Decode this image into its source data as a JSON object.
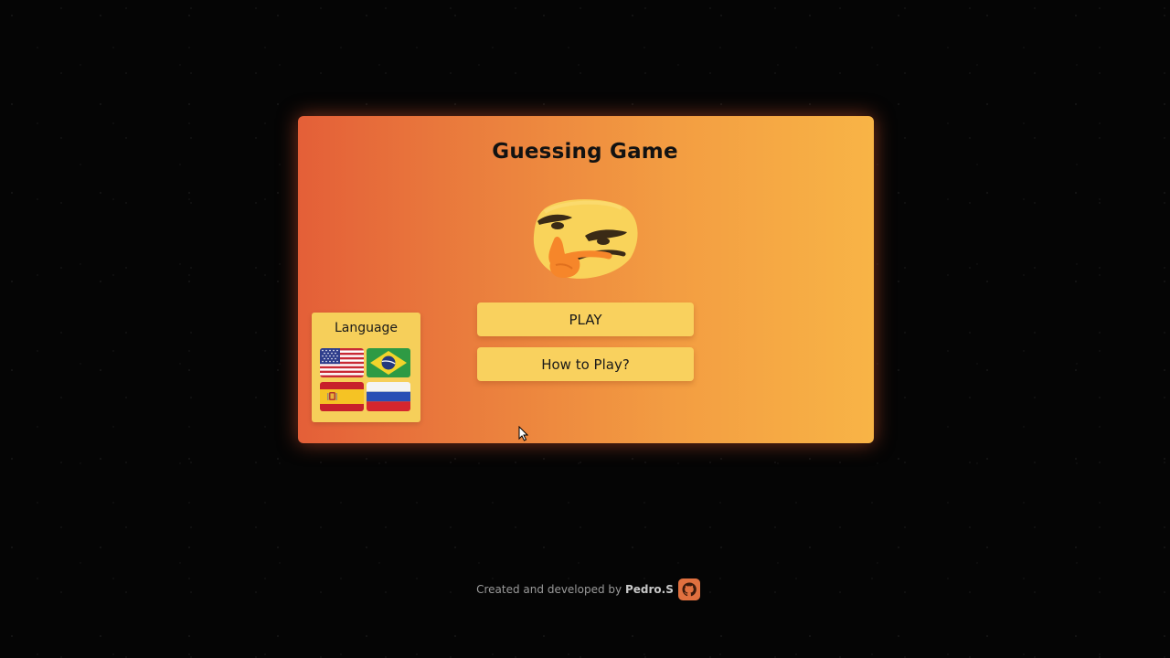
{
  "game": {
    "title": "Guessing Game",
    "mascot_icon": "thinking-face-emoji"
  },
  "menu": {
    "play_label": "PLAY",
    "how_to_play_label": "How to Play?"
  },
  "language": {
    "label": "Language",
    "flags": [
      {
        "name": "flag-us",
        "icon": "us-flag-icon"
      },
      {
        "name": "flag-brazil",
        "icon": "brazil-flag-icon"
      },
      {
        "name": "flag-spain",
        "icon": "spain-flag-icon"
      },
      {
        "name": "flag-russia",
        "icon": "russia-flag-icon"
      }
    ]
  },
  "footer": {
    "credit_text": "Created and developed by",
    "author": "Pedro.S",
    "icon": "github-icon"
  },
  "colors": {
    "card_gradient_start": "#e45f38",
    "card_gradient_end": "#f8b446",
    "button_fill": "#f9d15e",
    "language_panel_fill": "#f6cf5a",
    "background": "#050505"
  }
}
